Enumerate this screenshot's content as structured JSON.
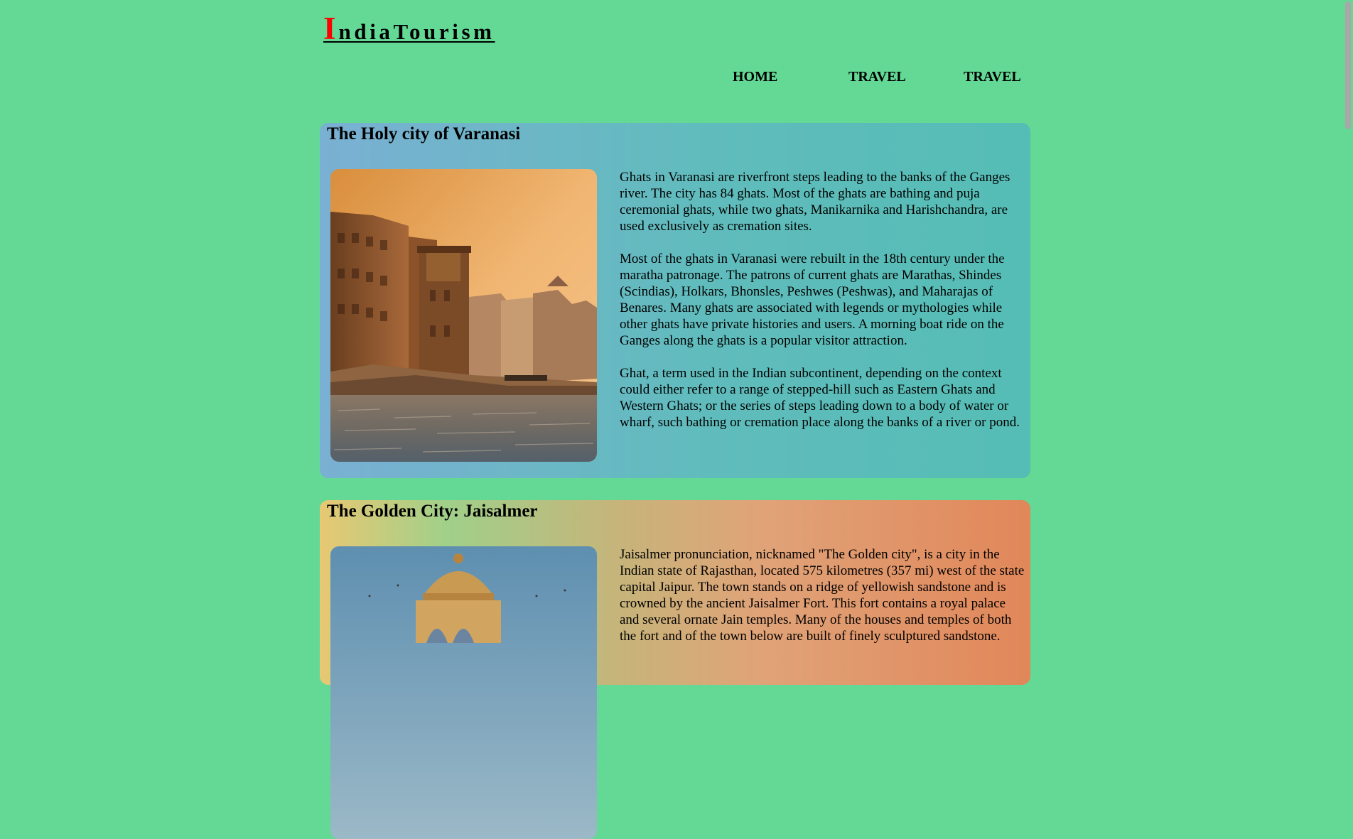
{
  "header": {
    "logo_first": "I",
    "logo_rest": "ndiaTourism",
    "nav": [
      "HOME",
      "TRAVEL",
      "TRAVEL"
    ],
    "logo_cap_color": "#ff0000"
  },
  "sections": [
    {
      "title": "The Holy city of Varanasi",
      "image_label": "varanasi-ghats-photo",
      "paragraphs": [
        "Ghats in Varanasi are riverfront steps leading to the banks of the Ganges river. The city has 84 ghats. Most of the ghats are bathing and puja ceremonial ghats, while two ghats, Manikarnika and Harishchandra, are used exclusively as cremation sites.",
        "Most of the ghats in Varanasi were rebuilt in the 18th century under the maratha patronage. The patrons of current ghats are Marathas, Shindes (Scindias), Holkars, Bhonsles, Peshwes (Peshwas), and Maharajas of Benares. Many ghats are associated with legends or mythologies while other ghats have private histories and users. A morning boat ride on the Ganges along the ghats is a popular visitor attraction.",
        "Ghat, a term used in the Indian subcontinent, depending on the context could either refer to a range of stepped-hill such as Eastern Ghats and Western Ghats; or the series of steps leading down to a body of water or wharf, such bathing or cremation place along the banks of a river or pond."
      ]
    },
    {
      "title": "The Golden City: Jaisalmer",
      "image_label": "jaisalmer-chhatri-photo",
      "paragraphs": [
        "Jaisalmer pronunciation, nicknamed \"The Golden city\", is a city in the Indian state of Rajasthan, located 575 kilometres (357 mi) west of the state capital Jaipur. The town stands on a ridge of yellowish sandstone and is crowned by the ancient Jaisalmer Fort. This fort contains a royal palace and several ornate Jain temples. Many of the houses and temples of both the fort and of the town below are built of finely sculptured sandstone."
      ]
    }
  ],
  "colors": {
    "page_background": "#63d995",
    "text": "#000000"
  }
}
